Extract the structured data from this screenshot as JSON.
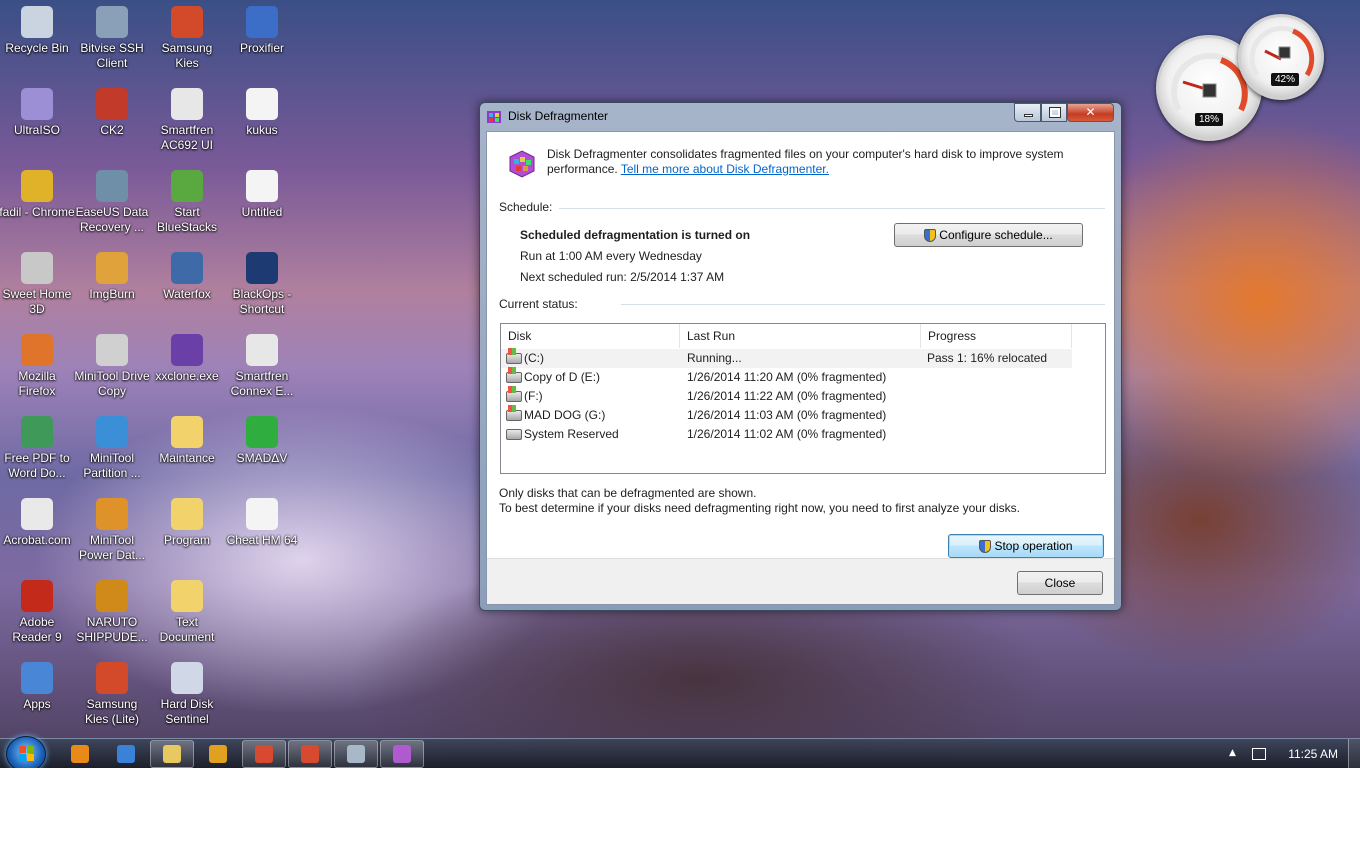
{
  "desktop": {
    "icons": [
      {
        "label": "Recycle Bin",
        "color": "#c9d4e0"
      },
      {
        "label": "Bitvise SSH Client",
        "color": "#8aa0b8"
      },
      {
        "label": "Samsung Kies",
        "color": "#d34a2a"
      },
      {
        "label": "Proxifier",
        "color": "#3c6ec8"
      },
      {
        "label": "UltraISO",
        "color": "#9c8fd6"
      },
      {
        "label": "CK2",
        "color": "#c23a2a"
      },
      {
        "label": "Smartfren AC692 UI",
        "color": "#e7e7e7"
      },
      {
        "label": "kukus",
        "color": "#f4f4f4"
      },
      {
        "label": "fadil - Chrome",
        "color": "#e0b22a"
      },
      {
        "label": "EaseUS Data Recovery ...",
        "color": "#6f8fa8"
      },
      {
        "label": "Start BlueStacks",
        "color": "#5aa840"
      },
      {
        "label": "Untitled",
        "color": "#f4f4f4"
      },
      {
        "label": "Sweet Home 3D",
        "color": "#c8c8c8"
      },
      {
        "label": "ImgBurn",
        "color": "#e0a23a"
      },
      {
        "label": "Waterfox",
        "color": "#3f6aa8"
      },
      {
        "label": "BlackOps - Shortcut",
        "color": "#1d3a72"
      },
      {
        "label": "Mozilla Firefox",
        "color": "#e0742a"
      },
      {
        "label": "MiniTool Drive Copy",
        "color": "#d0d0d0"
      },
      {
        "label": "xxclone.exe",
        "color": "#6b3fa8"
      },
      {
        "label": "Smartfren Connex E...",
        "color": "#e7e7e7"
      },
      {
        "label": "Free PDF to Word Do...",
        "color": "#3f9a5a"
      },
      {
        "label": "MiniTool Partition ...",
        "color": "#3a8fd6"
      },
      {
        "label": "Maintance",
        "color": "#f2d36b"
      },
      {
        "label": "SMADΔV",
        "color": "#2fae3f"
      },
      {
        "label": "Acrobat.com",
        "color": "#e9e9e9"
      },
      {
        "label": "MiniTool Power Dat...",
        "color": "#e0922a"
      },
      {
        "label": "Program",
        "color": "#f2d36b"
      },
      {
        "label": "Cheat HM 64",
        "color": "#f4f4f4"
      },
      {
        "label": "Adobe Reader 9",
        "color": "#c42a1a"
      },
      {
        "label": "NARUTO SHIPPUDE...",
        "color": "#d08a1a"
      },
      {
        "label": "Text Document",
        "color": "#f2d36b"
      },
      {
        "label": "Apps",
        "color": "#4a86d6"
      },
      {
        "label": "Samsung Kies (Lite)",
        "color": "#d34a2a"
      },
      {
        "label": "Hard Disk Sentinel",
        "color": "#d0d8e8"
      }
    ]
  },
  "gadget": {
    "cpu": "18%",
    "memory": "42%"
  },
  "window": {
    "title": "Disk Defragmenter",
    "intro_text": "Disk Defragmenter consolidates fragmented files on your computer's hard disk to improve system performance.",
    "intro_link": "Tell me more about Disk Defragmenter.",
    "schedule_label": "Schedule:",
    "schedule_status": "Scheduled defragmentation is turned on",
    "schedule_run": "Run at 1:00 AM every Wednesday",
    "schedule_next": "Next scheduled run: 2/5/2014 1:37 AM",
    "configure_button": "Configure schedule...",
    "current_status_label": "Current status:",
    "columns": [
      "Disk",
      "Last Run",
      "Progress"
    ],
    "disks": [
      {
        "name": "(C:)",
        "last_run": "Running...",
        "progress": "Pass 1: 16% relocated",
        "type": "win"
      },
      {
        "name": "Copy of D (E:)",
        "last_run": "1/26/2014 11:20 AM (0% fragmented)",
        "progress": "",
        "type": "win"
      },
      {
        "name": "(F:)",
        "last_run": "1/26/2014 11:22 AM (0% fragmented)",
        "progress": "",
        "type": "win"
      },
      {
        "name": "MAD DOG (G:)",
        "last_run": "1/26/2014 11:03 AM (0% fragmented)",
        "progress": "",
        "type": "win"
      },
      {
        "name": "System Reserved",
        "last_run": "1/26/2014 11:02 AM (0% fragmented)",
        "progress": "",
        "type": "plain"
      }
    ],
    "note1": "Only disks that can be defragmented are shown.",
    "note2": "To best determine if your disks need defragmenting right now, you need to first analyze your disks.",
    "stop_button": "Stop operation",
    "close_button": "Close"
  },
  "taskbar": {
    "clock": "11:25 AM",
    "items": [
      {
        "icon": "media-player-icon",
        "color": "#e78a1a",
        "open": false
      },
      {
        "icon": "ie-icon",
        "color": "#3a82d8",
        "open": false
      },
      {
        "icon": "explorer-icon",
        "color": "#e8c860",
        "open": true
      },
      {
        "icon": "bluetooth-icon",
        "color": "#e0a020",
        "open": false
      },
      {
        "icon": "chrome-icon",
        "color": "#d84a30",
        "open": true
      },
      {
        "icon": "chrome-icon",
        "color": "#d84a30",
        "open": true
      },
      {
        "icon": "paint-icon",
        "color": "#a8b8c8",
        "open": true
      },
      {
        "icon": "defrag-icon",
        "color": "#b05ad0",
        "open": true
      }
    ]
  }
}
